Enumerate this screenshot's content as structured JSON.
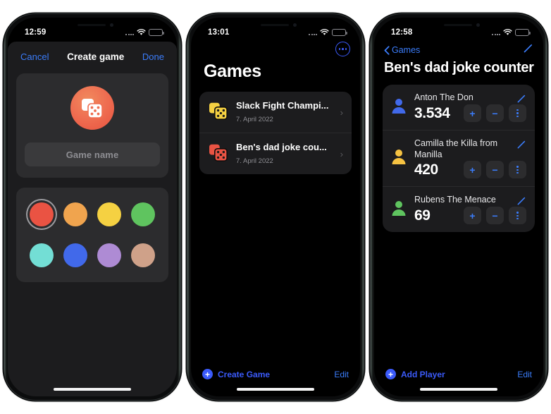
{
  "phones": [
    {
      "id": "create-game",
      "status": {
        "time": "12:59",
        "battery_pct": 55
      },
      "nav": {
        "cancel": "Cancel",
        "title": "Create game",
        "done": "Done"
      },
      "icon": {
        "name": "dice-icon",
        "circle_color": "#ef6f52"
      },
      "input": {
        "placeholder": "Game name",
        "value": ""
      },
      "colors": {
        "selected_index": 0,
        "swatches": [
          "#ea5343",
          "#f0a44e",
          "#f5d142",
          "#5fc45f",
          "#73ded5",
          "#4169ea",
          "#ae8bd4",
          "#cfa189"
        ]
      }
    },
    {
      "id": "games-list",
      "status": {
        "time": "13:01",
        "battery_pct": 55
      },
      "more_button": "more-options",
      "title": "Games",
      "games": [
        {
          "name": "Slack Fight Champi...",
          "date": "7. April 2022",
          "dice_color": "#f5d142"
        },
        {
          "name": "Ben's dad joke cou...",
          "date": "7. April 2022",
          "dice_color": "#ea5343"
        }
      ],
      "tabbar": {
        "primary": "Create Game",
        "secondary": "Edit"
      }
    },
    {
      "id": "player-counter",
      "status": {
        "time": "12:58",
        "battery_pct": 55
      },
      "back_label": "Games",
      "title": "Ben's dad joke counter",
      "players": [
        {
          "name": "Anton The Don",
          "score": "3.534",
          "avatar_color": "#4169ea"
        },
        {
          "name": "Camilla the Killa from Manilla",
          "score": "420",
          "avatar_color": "#f5c242"
        },
        {
          "name": "Rubens The Menace",
          "score": "69",
          "avatar_color": "#5fc45f"
        }
      ],
      "row_buttons": {
        "increment": "+",
        "decrement": "−",
        "more": "more-icon"
      },
      "tabbar": {
        "primary": "Add Player",
        "secondary": "Edit"
      }
    }
  ],
  "theme": {
    "accent_blue": "#3b7dfb",
    "accent_indigo": "#3b5bfb",
    "bg_black": "#000000",
    "card_gray": "#1c1c1e",
    "control_gray": "#2c2c2e",
    "text_secondary": "#8e8e93"
  }
}
